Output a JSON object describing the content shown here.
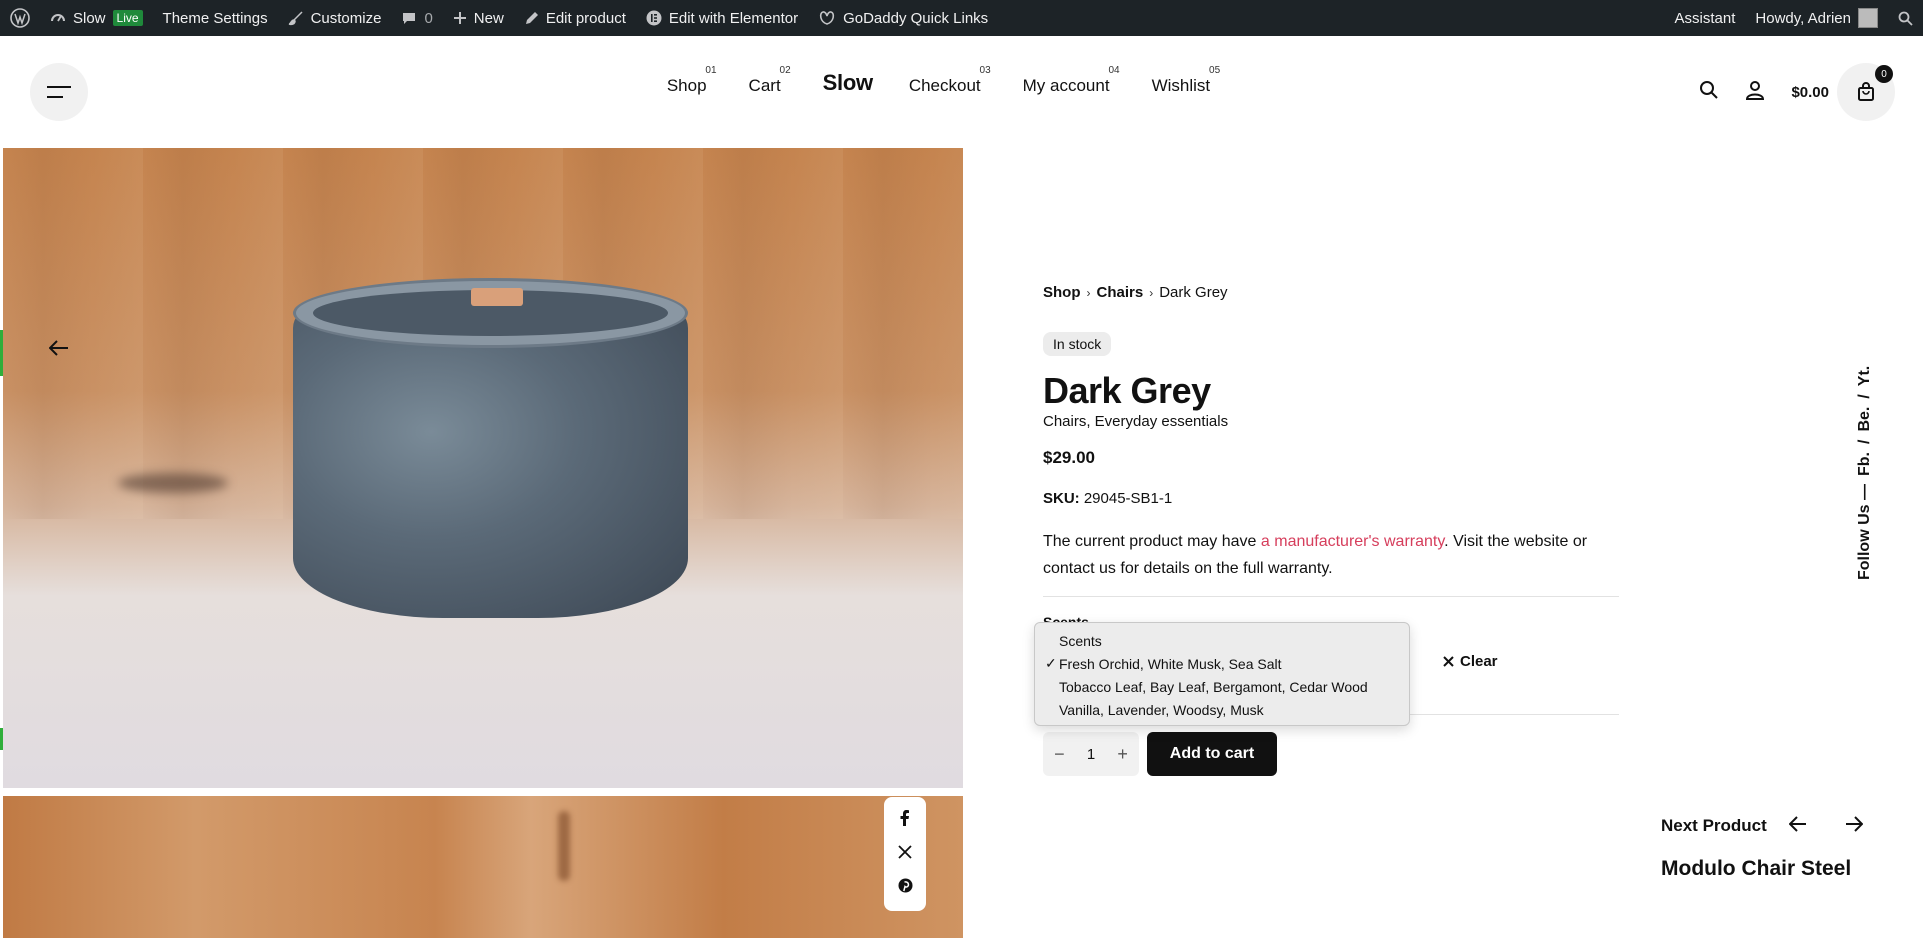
{
  "admin_bar": {
    "site_name": "Slow",
    "live_badge": "Live",
    "theme_settings": "Theme Settings",
    "customize": "Customize",
    "comments_count": "0",
    "new": "New",
    "edit_product": "Edit product",
    "edit_elementor": "Edit with Elementor",
    "godaddy": "GoDaddy Quick Links",
    "assistant": "Assistant",
    "howdy": "Howdy, Adrien"
  },
  "header": {
    "logo": "Slow",
    "nav": [
      {
        "label": "Shop",
        "num": "01"
      },
      {
        "label": "Cart",
        "num": "02"
      },
      {
        "label": "Checkout",
        "num": "03"
      },
      {
        "label": "My account",
        "num": "04"
      },
      {
        "label": "Wishlist",
        "num": "05"
      }
    ],
    "cart_total": "$0.00",
    "cart_count": "0"
  },
  "product": {
    "breadcrumb": [
      "Shop",
      "Chairs",
      "Dark Grey"
    ],
    "stock": "In stock",
    "title": "Dark Grey",
    "categories": "Chairs, Everyday essentials",
    "price": "$29.00",
    "sku_label": "SKU:",
    "sku_value": "29045-SB1-1",
    "desc_before": "The current product may have ",
    "desc_link": "a manufacturer's warranty",
    "desc_after": ". Visit the website or contact us for details on the full warranty.",
    "variation_label": "Scents",
    "clear": "Clear",
    "quantity": "1",
    "add_to_cart": "Add to cart"
  },
  "dropdown": {
    "options": [
      "Scents",
      "Fresh Orchid, White Musk, Sea Salt",
      "Tobacco Leaf, Bay Leaf, Bergamont, Cedar Wood",
      "Vanilla, Lavender, Woodsy, Musk"
    ],
    "selected": "Fresh Orchid, White Musk, Sea Salt",
    "check": "✓"
  },
  "follow": {
    "text": "Follow Us —",
    "links": [
      "Fb.",
      "/",
      "Be.",
      "/",
      "Yt."
    ]
  },
  "next_product": {
    "label": "Next Product",
    "name": "Modulo Chair Steel"
  },
  "colors": {
    "admin_bg": "#1d2327",
    "accent_link": "#d63e5c",
    "button_bg": "#111111"
  }
}
